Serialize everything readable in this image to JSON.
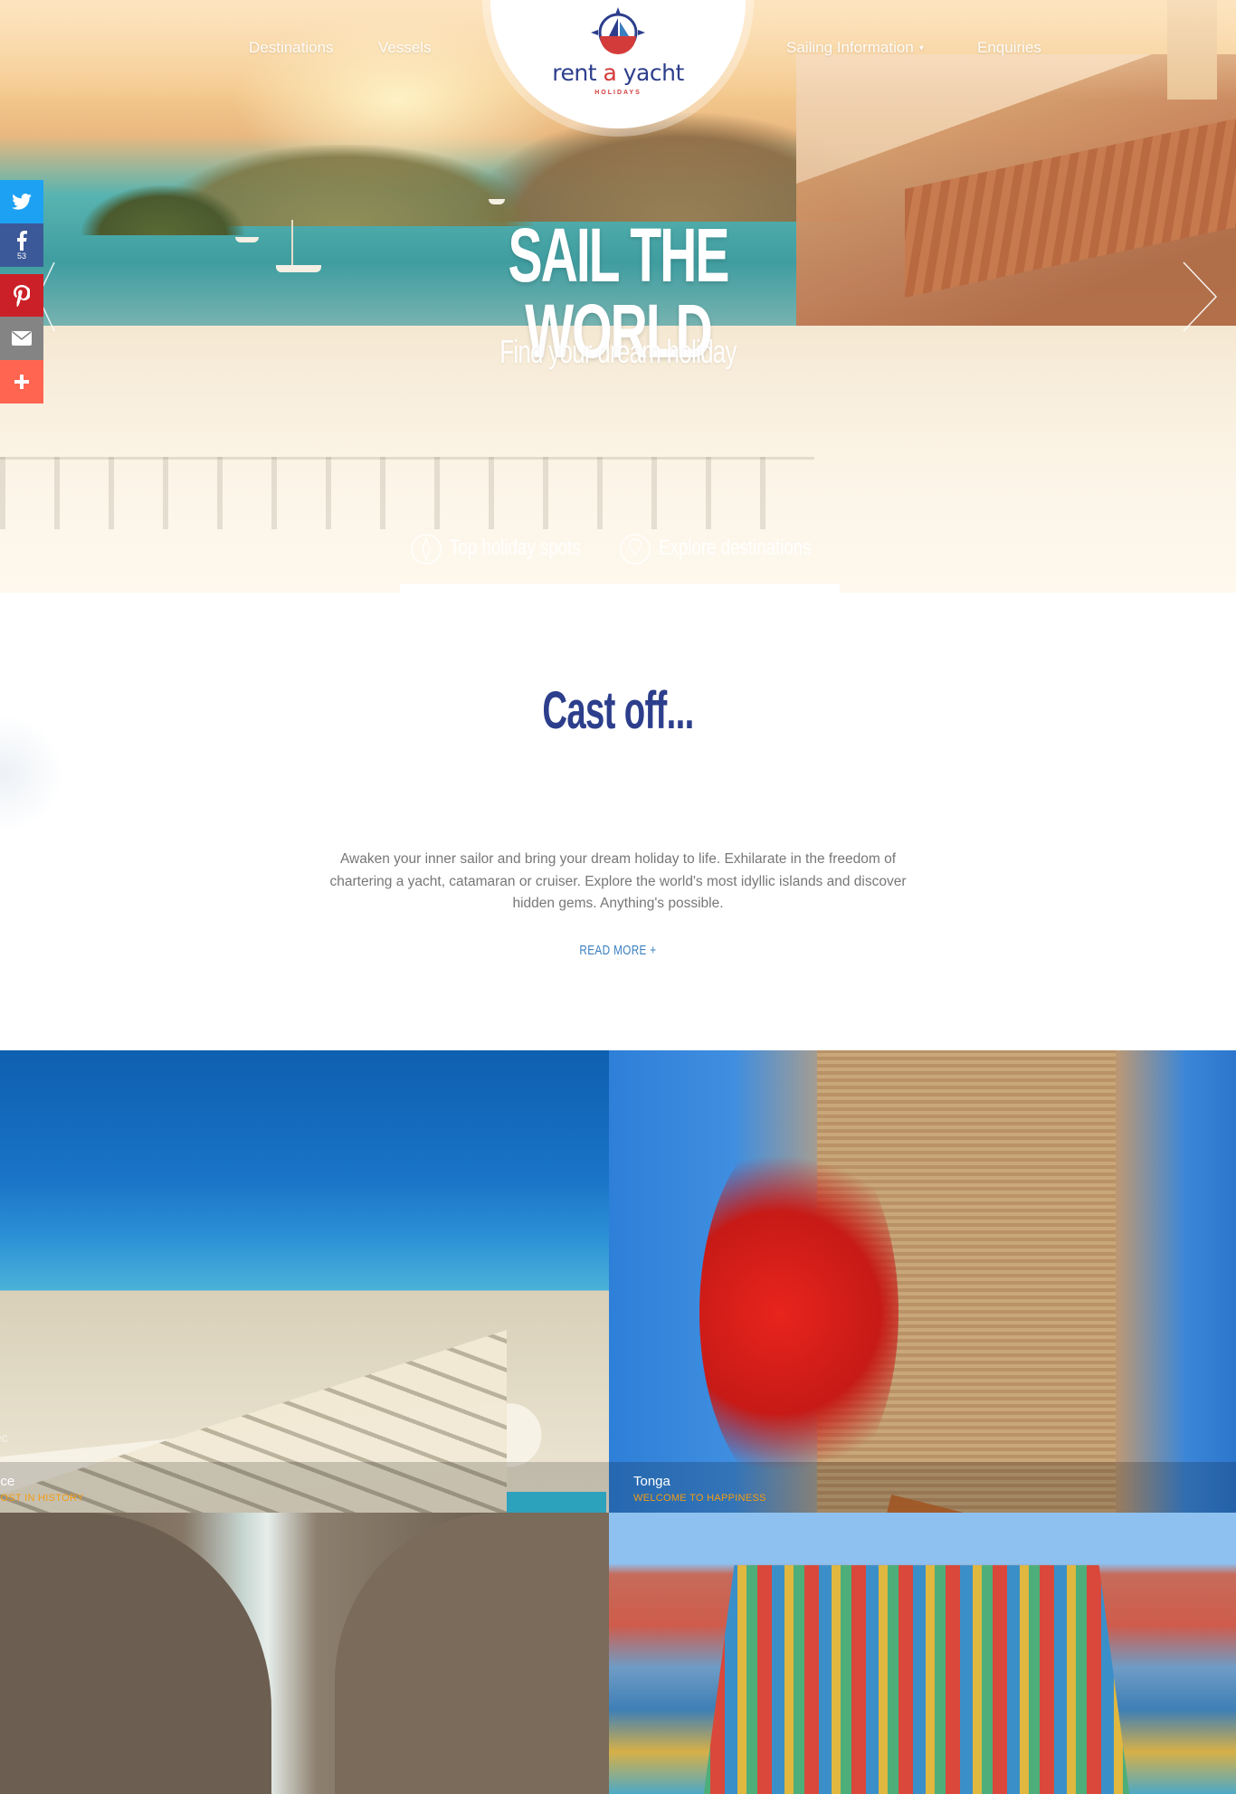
{
  "nav": {
    "left": [
      "Destinations",
      "Vessels"
    ],
    "right": [
      "Sailing Information",
      "Enquiries"
    ],
    "dropdown_caret": "▾"
  },
  "logo": {
    "word_rent": "rent",
    "word_a": "a",
    "word_yacht": "yacht",
    "subtitle": "HOLIDAYS"
  },
  "hero": {
    "title": "SAIL THE WORLD",
    "subtitle": "Find your dream holiday",
    "features": [
      {
        "label": "Top holiday spots",
        "icon": "compass-icon"
      },
      {
        "label": "Explore destinations",
        "icon": "map-pin-icon"
      }
    ]
  },
  "social": {
    "facebook_count": "53",
    "buttons": [
      "twitter-icon",
      "facebook-icon",
      "pinterest-icon",
      "email-icon",
      "plus-icon"
    ]
  },
  "intro": {
    "title": "Cast off...",
    "text": "Awaken your inner sailor and bring your dream holiday to life. Exhilarate in the freedom of chartering a yacht, catamaran or cruiser. Explore the world's most idyllic islands and discover hidden gems. Anything's possible.",
    "read_more": "READ MORE +"
  },
  "tiles": [
    {
      "name": "ece",
      "tagline": "LOST IN HISTORY",
      "ghost": "ec"
    },
    {
      "name": "Tonga",
      "tagline": "WELCOME TO HAPPINESS"
    }
  ],
  "colors": {
    "brand_navy": "#2c3e8c",
    "brand_red": "#d33b3b",
    "tagline_orange": "#f39c12",
    "link_blue": "#3a7fc0",
    "twitter": "#1da1f2",
    "facebook": "#3b5998",
    "pinterest": "#cb2027",
    "email": "#848484",
    "more": "#ff6550"
  }
}
